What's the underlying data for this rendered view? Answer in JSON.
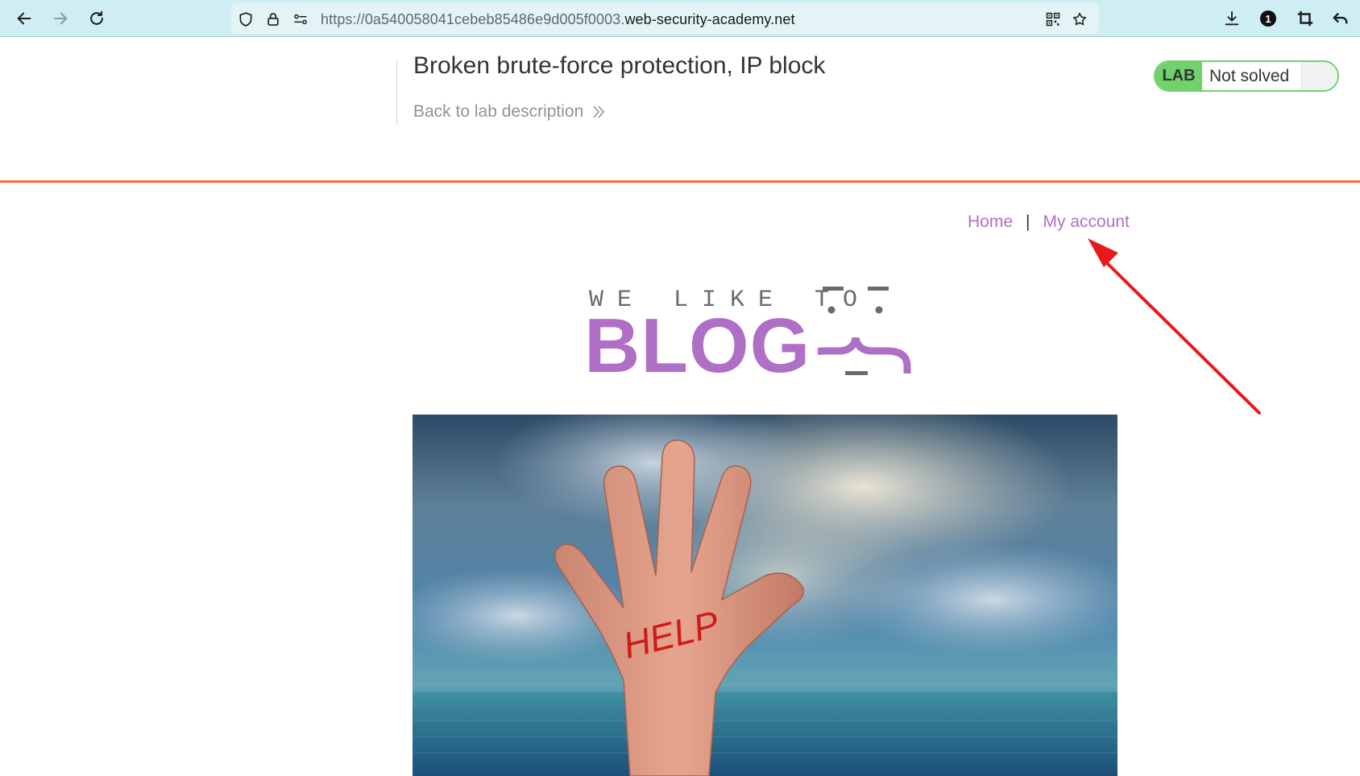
{
  "browser": {
    "url_prefix": "https://0a540058041cebeb85486e9d005f0003.",
    "url_domain": "web-security-academy.net",
    "extension_badge": "1"
  },
  "lab": {
    "title": "Broken brute-force protection, IP block",
    "back_link": "Back to lab description",
    "status_badge": "LAB",
    "status_text": "Not solved"
  },
  "nav": {
    "home": "Home",
    "separator": "|",
    "my_account": "My account"
  },
  "logo": {
    "small_text": "WE LIKE TO",
    "big_text": "BLOG"
  },
  "hero": {
    "hand_text": "HELP"
  },
  "colors": {
    "accent_purple": "#b06fc6",
    "lab_green": "#70d16d",
    "orange_rule": "#ff6633",
    "annotation_red": "#e8191c"
  }
}
